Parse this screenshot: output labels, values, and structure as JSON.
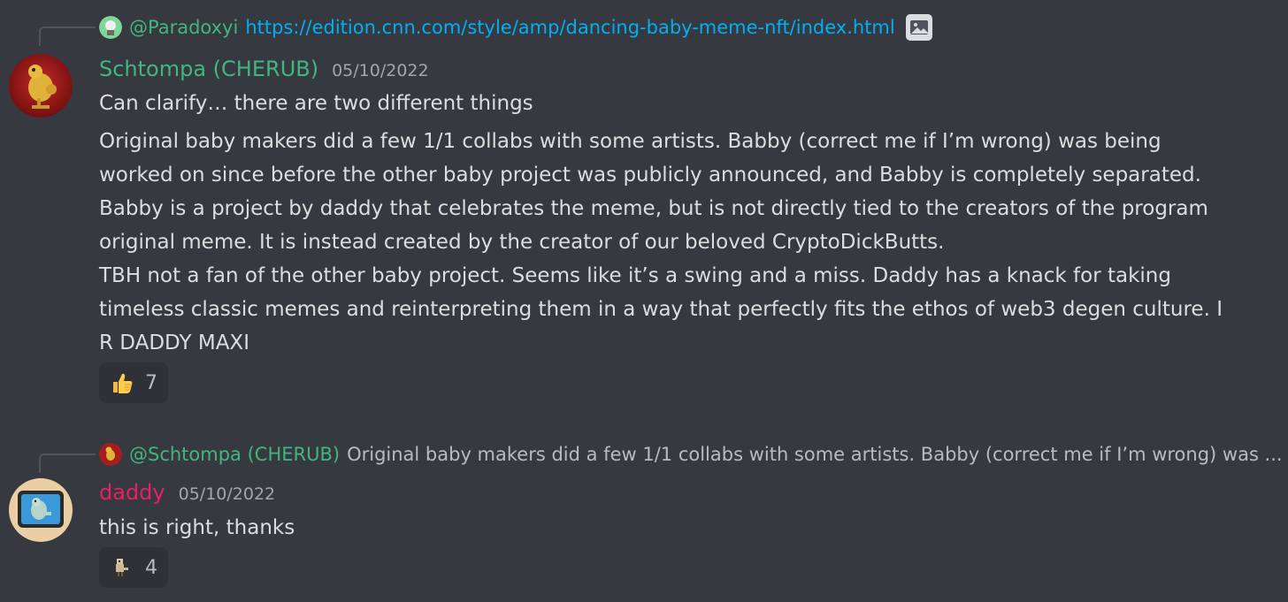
{
  "colors": {
    "background": "#36393f",
    "link": "#00aff4",
    "username_green": "#43b581",
    "username_pink": "#e91e63",
    "text": "#dcddde",
    "muted": "#a3a6aa"
  },
  "messages": [
    {
      "reply": {
        "user": "@Paradoxyi",
        "text": "https://edition.cnn.com/style/amp/dancing-baby-meme-nft/index.html",
        "attachment_icon": "image-icon"
      },
      "author": "Schtompa (CHERUB)",
      "timestamp": "05/10/2022",
      "first_line": "Can clarify… there are two different things",
      "paragraph": [
        "Original baby makers did a few 1/1 collabs with some artists. Babby (correct me if I’m wrong) was being",
        "worked on since before the other baby project was publicly announced, and Babby is completely separated.",
        "Babby is a project by daddy that celebrates the meme, but is not directly tied to the creators of the program",
        "original meme. It is instead created by the creator of our beloved CryptoDickButts.",
        "TBH not a fan of the other baby project. Seems like it’s a swing and a miss. Daddy has a knack for taking",
        "timeless classic memes and reinterpreting them in a way that perfectly fits the ethos of web3 degen culture. I",
        "R DADDY MAXI"
      ],
      "reaction": {
        "emoji": "thumbs-up",
        "count": "7"
      }
    },
    {
      "reply": {
        "user": "@Schtompa (CHERUB)",
        "text": "Original baby makers did a few 1/1 collabs with some artists. Babby (correct me if I’m wrong) was ..."
      },
      "author": "daddy",
      "timestamp": "05/10/2022",
      "first_line": "this is right, thanks",
      "reaction": {
        "emoji": "pixel-bird",
        "count": "4"
      }
    }
  ]
}
